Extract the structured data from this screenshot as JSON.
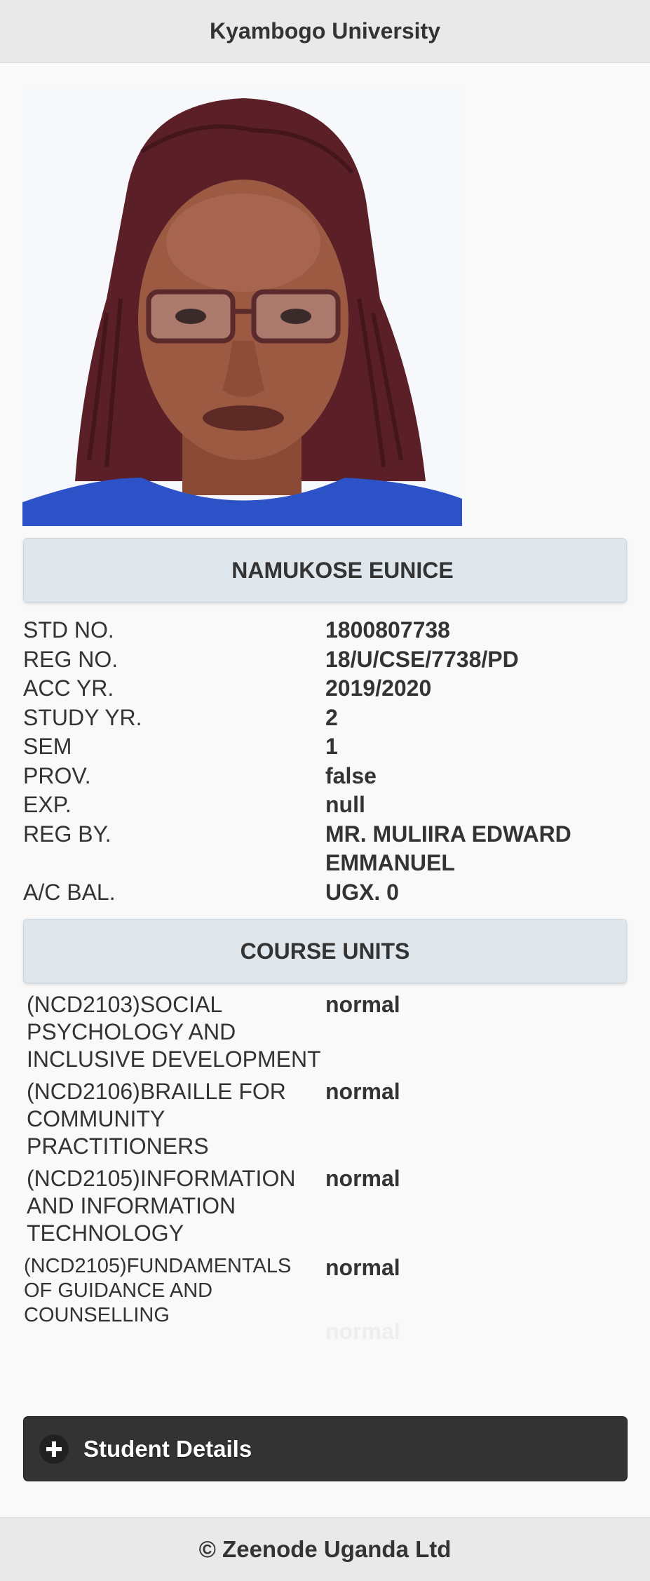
{
  "header": {
    "title": "Kyambogo University"
  },
  "student": {
    "name": "NAMUKOSE EUNICE",
    "fields": [
      {
        "label": "STD NO.",
        "value": "1800807738"
      },
      {
        "label": "REG NO.",
        "value": "18/U/CSE/7738/PD"
      },
      {
        "label": "ACC YR.",
        "value": "2019/2020"
      },
      {
        "label": "STUDY YR.",
        "value": "2"
      },
      {
        "label": "SEM",
        "value": "1"
      },
      {
        "label": "PROV.",
        "value": "false"
      },
      {
        "label": "EXP.",
        "value": "null"
      },
      {
        "label": "REG BY.",
        "value": "MR. MULIIRA EDWARD EMMANUEL"
      },
      {
        "label": "A/C BAL.",
        "value": "UGX. 0"
      }
    ]
  },
  "course_units": {
    "title": "COURSE UNITS",
    "items": [
      {
        "name": "(NCD2103)SOCIAL PSYCHOLOGY AND INCLUSIVE DEVELOPMENT",
        "status": "normal"
      },
      {
        "name": "(NCD2106)BRAILLE FOR COMMUNITY PRACTITIONERS",
        "status": "normal"
      },
      {
        "name": "(NCD2105)INFORMATION AND INFORMATION TECHNOLOGY",
        "status": "normal"
      },
      {
        "name": "(NCD2105)FUNDAMENTALS OF GUIDANCE AND COUNSELLING",
        "status": "normal"
      }
    ],
    "faded_status": "normal"
  },
  "student_details": {
    "label": "Student Details",
    "icon": "plus-icon"
  },
  "footer": {
    "text": "© Zeenode Uganda Ltd"
  },
  "colors": {
    "header_bg": "#e9e9e9",
    "bar_bg": "#dfe7ed",
    "button_bg": "#333333",
    "text": "#333333"
  }
}
